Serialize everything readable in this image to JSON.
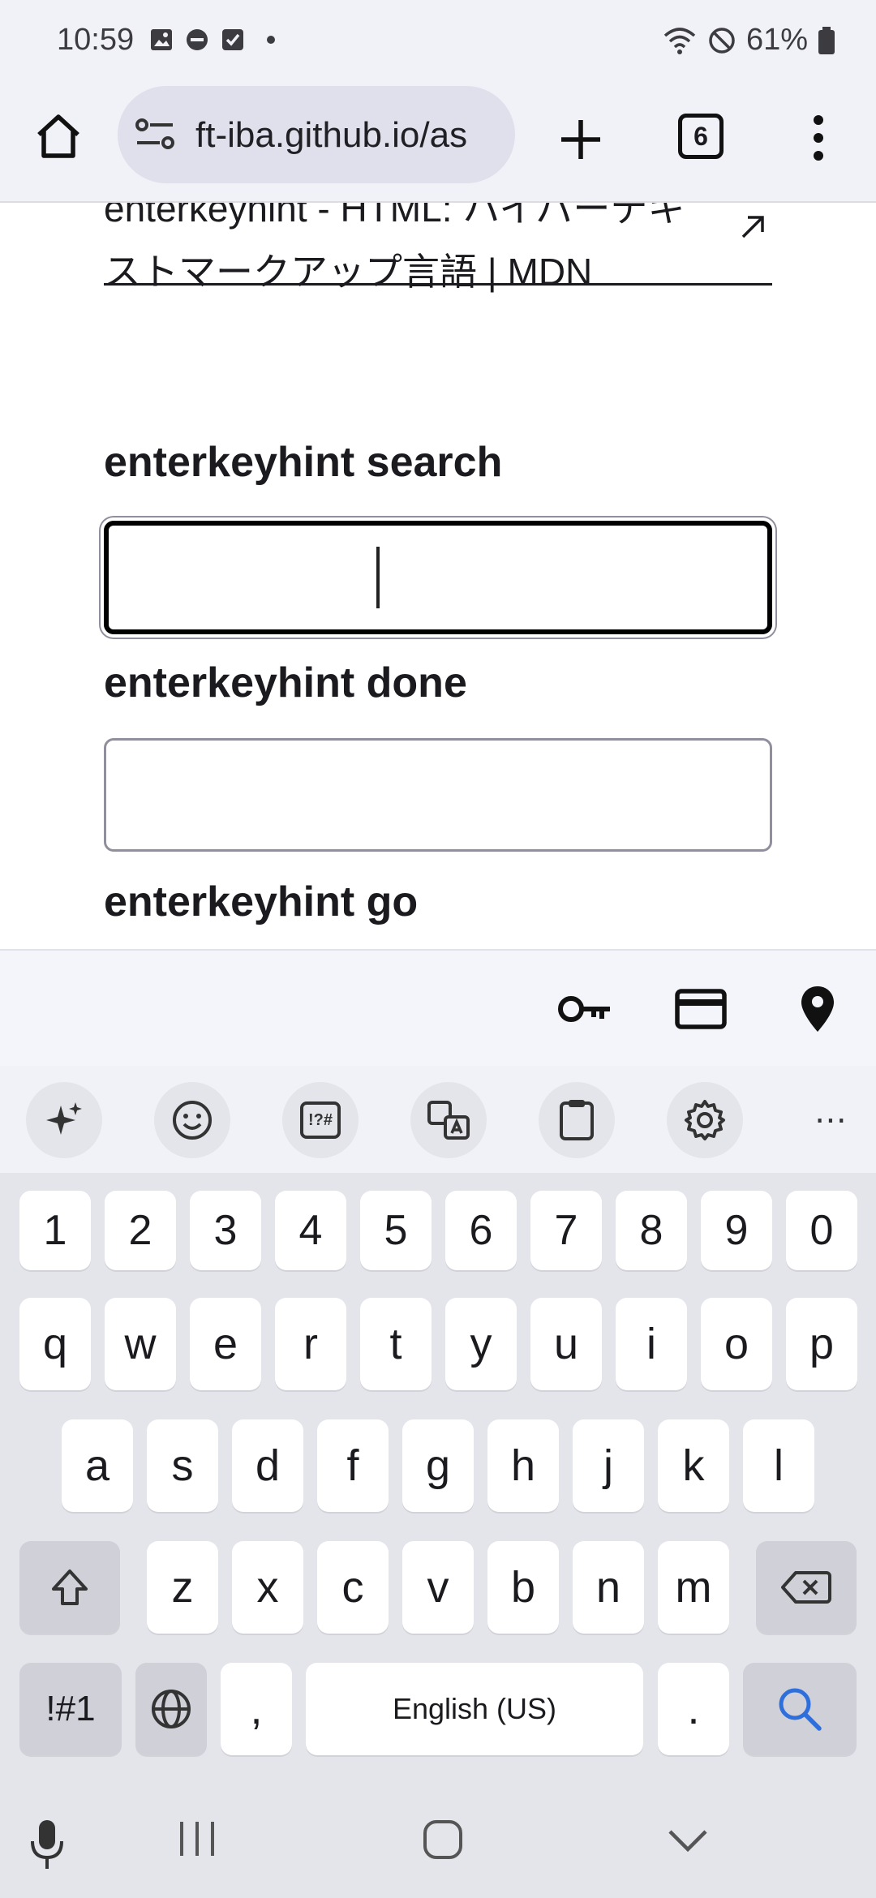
{
  "status_bar": {
    "time": "10:59",
    "battery": "61%",
    "left_icons": [
      "image-icon",
      "dnd-icon",
      "checkbox-icon",
      "dot-icon"
    ],
    "right_icons": [
      "wifi-icon",
      "block-icon",
      "battery-icon"
    ]
  },
  "browser": {
    "url": "ft-iba.github.io/as",
    "tab_count": "6"
  },
  "page": {
    "link_text": "enterkeyhint - HTML: ハイパーテキストマークアップ言語 | MDN",
    "fields": [
      {
        "label": "enterkeyhint search",
        "value": "",
        "focused": true
      },
      {
        "label": "enterkeyhint done",
        "value": "",
        "focused": false
      },
      {
        "label": "enterkeyhint go",
        "value": "",
        "focused": false
      }
    ]
  },
  "autofill": {
    "icons": [
      "key-icon",
      "credit-card-icon",
      "location-pin-icon"
    ]
  },
  "keyboard_toolbar": {
    "icons": [
      "sparkle-icon",
      "emoji-icon",
      "symbols-icon",
      "translate-icon",
      "clipboard-icon",
      "settings-icon",
      "more-icon"
    ],
    "symbols_label": "!?#",
    "more_label": "⋯"
  },
  "keyboard": {
    "number_row": [
      "1",
      "2",
      "3",
      "4",
      "5",
      "6",
      "7",
      "8",
      "9",
      "0"
    ],
    "row1": [
      "q",
      "w",
      "e",
      "r",
      "t",
      "y",
      "u",
      "i",
      "o",
      "p"
    ],
    "row2": [
      "a",
      "s",
      "d",
      "f",
      "g",
      "h",
      "j",
      "k",
      "l"
    ],
    "row3": [
      "z",
      "x",
      "c",
      "v",
      "b",
      "n",
      "m"
    ],
    "symbols_key": "!#1",
    "comma_key": ",",
    "space_label": "English (US)",
    "period_key": ".",
    "action_key": "search-icon",
    "action_color": "#2f6fdb"
  },
  "navbar": {
    "icons": [
      "mic-icon",
      "recent-apps-icon",
      "home-icon",
      "back-chevron-icon"
    ]
  }
}
